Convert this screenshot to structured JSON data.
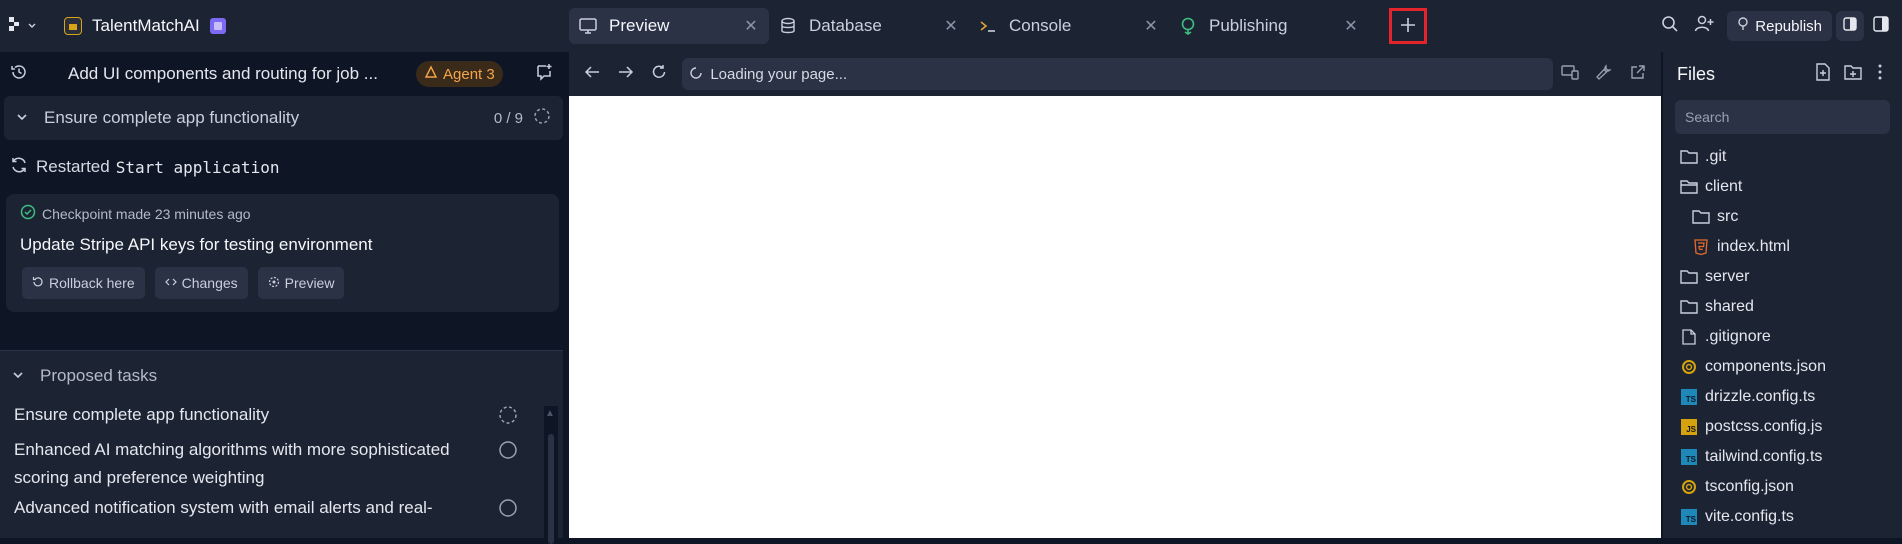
{
  "app": {
    "name": "TalentMatchAI"
  },
  "tabs": [
    {
      "label": "Preview",
      "icon": "monitor-icon",
      "active": true
    },
    {
      "label": "Database",
      "icon": "database-icon",
      "active": false
    },
    {
      "label": "Console",
      "icon": "terminal-icon",
      "active": false
    },
    {
      "label": "Publishing",
      "icon": "publishing-icon",
      "active": false
    }
  ],
  "topbar": {
    "republish_label": "Republish"
  },
  "thread": {
    "title": "Add UI components and routing for job ...",
    "agent_badge": "Agent 3"
  },
  "current_task": {
    "label": "Ensure complete app functionality",
    "count": "0 / 9"
  },
  "restart": {
    "label": "Restarted",
    "command": "Start application"
  },
  "checkpoint": {
    "meta": "Checkpoint made 23 minutes ago",
    "title": "Update Stripe API keys for testing environment",
    "actions": {
      "rollback": "Rollback here",
      "changes": "Changes",
      "preview": "Preview"
    }
  },
  "proposed": {
    "header": "Proposed tasks",
    "items": [
      "Ensure complete app functionality",
      "Enhanced AI matching algorithms with more sophisticated scoring and preference weighting",
      "Advanced notification system with email alerts and real-"
    ]
  },
  "preview": {
    "url_status": "Loading your page..."
  },
  "files": {
    "title": "Files",
    "search_placeholder": "Search",
    "items": [
      {
        "name": ".git",
        "type": "folder"
      },
      {
        "name": "client",
        "type": "folder-open"
      },
      {
        "name": "src",
        "type": "folder"
      },
      {
        "name": "index.html",
        "type": "html"
      },
      {
        "name": "server",
        "type": "folder"
      },
      {
        "name": "shared",
        "type": "folder"
      },
      {
        "name": ".gitignore",
        "type": "file"
      },
      {
        "name": "components.json",
        "type": "json"
      },
      {
        "name": "drizzle.config.ts",
        "type": "ts"
      },
      {
        "name": "postcss.config.js",
        "type": "js"
      },
      {
        "name": "tailwind.config.ts",
        "type": "ts"
      },
      {
        "name": "tsconfig.json",
        "type": "json"
      },
      {
        "name": "vite.config.ts",
        "type": "ts"
      }
    ]
  },
  "colors": {
    "accent_agent": "#f5a549",
    "highlight_border": "#e3242b",
    "success": "#3fbf7f"
  }
}
